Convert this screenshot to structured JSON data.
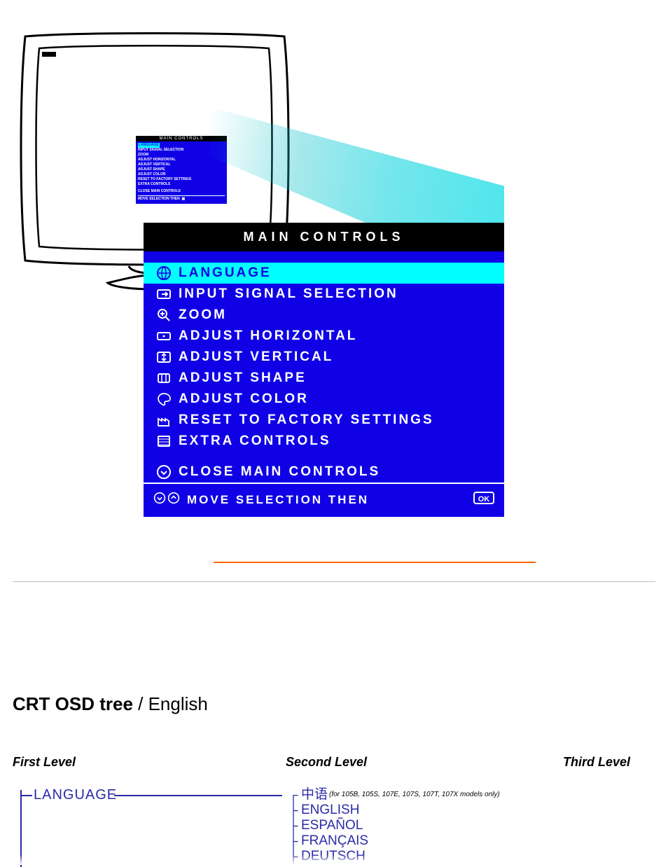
{
  "osd": {
    "title": "MAIN CONTROLS",
    "items": [
      {
        "icon": "globe-icon",
        "label": "LANGUAGE",
        "selected": true
      },
      {
        "icon": "input-icon",
        "label": "INPUT SIGNAL SELECTION",
        "selected": false
      },
      {
        "icon": "zoom-icon",
        "label": "ZOOM",
        "selected": false
      },
      {
        "icon": "horiz-icon",
        "label": "ADJUST HORIZONTAL",
        "selected": false
      },
      {
        "icon": "vert-icon",
        "label": "ADJUST VERTICAL",
        "selected": false
      },
      {
        "icon": "shape-icon",
        "label": "ADJUST SHAPE",
        "selected": false
      },
      {
        "icon": "color-icon",
        "label": "ADJUST COLOR",
        "selected": false
      },
      {
        "icon": "factory-icon",
        "label": "RESET TO FACTORY SETTINGS",
        "selected": false
      },
      {
        "icon": "extra-icon",
        "label": "EXTRA CONTROLS",
        "selected": false
      }
    ],
    "close_item": {
      "icon": "down-circle-icon",
      "label": "CLOSE MAIN CONTROLS"
    },
    "footer": {
      "label": "MOVE SELECTION THEN",
      "nav_icons": [
        "down-circle-icon",
        "up-circle-icon"
      ],
      "ok_icon": "ok-icon"
    }
  },
  "mini_osd": {
    "title": "MAIN CONTROLS",
    "lines": [
      "LANGUAGE",
      "INPUT SIGNAL SELECTION",
      "ZOOM",
      "ADJUST HORIZONTAL",
      "ADJUST VERTICAL",
      "ADJUST SHAPE",
      "ADJUST COLOR",
      "RESET TO FACTORY SETTINGS",
      "EXTRA CONTROLS"
    ],
    "close": "CLOSE MAIN CONTROLS",
    "footer": "MOVE SELECTION THEN"
  },
  "heading": {
    "bold": "CRT OSD tree",
    "rest": " / English"
  },
  "levels": {
    "first": "First Level",
    "second": "Second Level",
    "third": "Third Level"
  },
  "tree": {
    "first": "LANGUAGE",
    "second": [
      {
        "label": "中语",
        "note": "(for 105B, 105S, 107E, 107S, 107T, 107X models only)"
      },
      {
        "label": "ENGLISH"
      },
      {
        "label": "ESPAÑOL"
      },
      {
        "label": "FRANÇAIS"
      },
      {
        "label": "DEUTSCH"
      }
    ]
  }
}
